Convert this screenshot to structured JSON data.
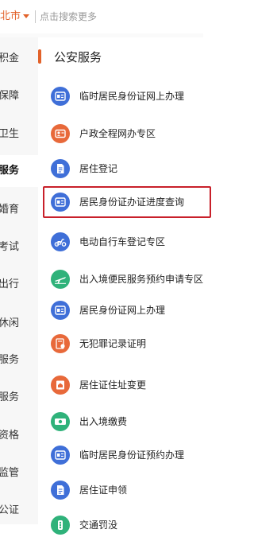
{
  "header": {
    "city": "北市",
    "search_placeholder": "点击搜索更多"
  },
  "sidebar": {
    "items": [
      {
        "label": "积金",
        "active": false
      },
      {
        "label": "保障",
        "active": false
      },
      {
        "label": "卫生",
        "active": false
      },
      {
        "label": "服务",
        "active": true
      },
      {
        "label": "婚育",
        "active": false
      },
      {
        "label": "考试",
        "active": false
      },
      {
        "label": "出行",
        "active": false
      },
      {
        "label": "休闲",
        "active": false
      },
      {
        "label": "服务",
        "active": false
      },
      {
        "label": "服务",
        "active": false
      },
      {
        "label": "资格",
        "active": false
      },
      {
        "label": "监管",
        "active": false
      },
      {
        "label": "公证",
        "active": false
      }
    ]
  },
  "main": {
    "section_title": "公安服务",
    "services": [
      {
        "label": "临时居民身份证网上办理",
        "icon": "id-card-icon",
        "color": "#3f6fd8"
      },
      {
        "label": "户政全程网办专区",
        "icon": "household-icon",
        "color": "#e8693a"
      },
      {
        "label": "居住登记",
        "icon": "document-icon",
        "color": "#3f6fd8"
      },
      {
        "label": "居民身份证办证进度查询",
        "icon": "id-card-icon",
        "color": "#3f6fd8",
        "highlighted": true
      },
      {
        "label": "电动自行车登记专区",
        "icon": "scooter-icon",
        "color": "#3f6fd8"
      },
      {
        "label": "出入境便民服务预约申请专区",
        "icon": "airplane-icon",
        "color": "#2fb27a"
      },
      {
        "label": "居民身份证网上办理",
        "icon": "id-card-icon",
        "color": "#3f6fd8"
      },
      {
        "label": "无犯罪记录证明",
        "icon": "certificate-icon",
        "color": "#e8693a"
      },
      {
        "label": "居住证住址变更",
        "icon": "residence-permit-icon",
        "color": "#e8693a"
      },
      {
        "label": "出入境缴费",
        "icon": "payment-icon",
        "color": "#2fb27a"
      },
      {
        "label": "临时居民身份证预约办理",
        "icon": "id-card-icon",
        "color": "#3f6fd8"
      },
      {
        "label": "居住证申领",
        "icon": "document-icon",
        "color": "#3f6fd8"
      },
      {
        "label": "交通罚没",
        "icon": "traffic-icon",
        "color": "#2fb27a"
      }
    ]
  }
}
